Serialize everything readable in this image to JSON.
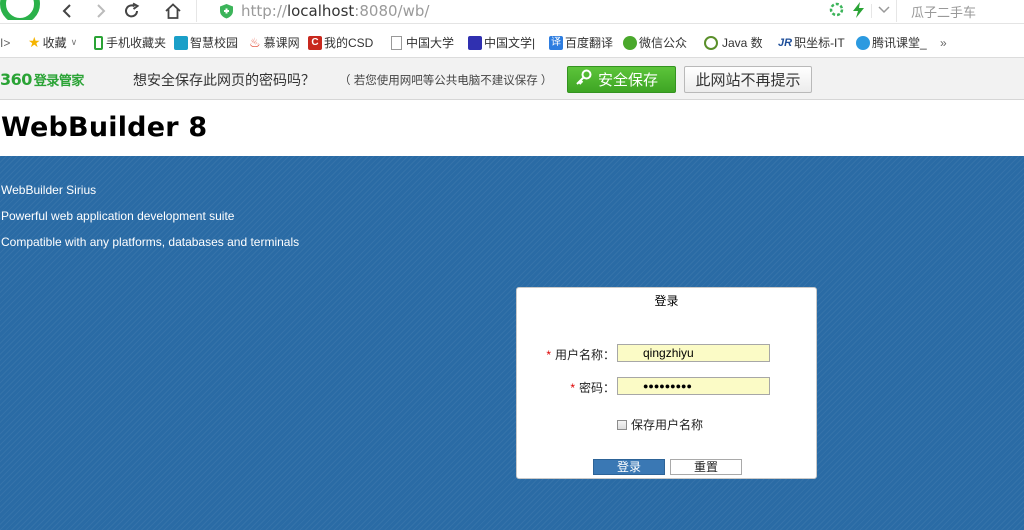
{
  "browser": {
    "url_prefix": "http://",
    "url_host": "localhost",
    "url_rest": ":8080/wb/",
    "search_hint": "瓜子二手车"
  },
  "bookmarks": [
    {
      "label": "收藏",
      "icon": "star-icon",
      "color": "#f5b400"
    },
    {
      "label": "手机收藏夹",
      "icon": "phone-icon",
      "color": "#2aa335"
    },
    {
      "label": "智慧校园",
      "icon": "campus-icon",
      "color": "#1a9fc8"
    },
    {
      "label": "慕课网",
      "icon": "flame-icon",
      "color": "#e0402a"
    },
    {
      "label": "我的CSD",
      "icon": "csdn-icon",
      "color": "#c8281e"
    },
    {
      "label": "中国大学",
      "icon": "page-icon",
      "color": "#888888"
    },
    {
      "label": "中国文学|",
      "icon": "book-icon",
      "color": "#3030b0"
    },
    {
      "label": "百度翻译",
      "icon": "translate-icon",
      "color": "#2d7de0"
    },
    {
      "label": "微信公众",
      "icon": "wechat-icon",
      "color": "#4aa82c"
    },
    {
      "label": "Java 数",
      "icon": "java-icon",
      "color": "#5a8f2a"
    },
    {
      "label": "职坐标-IT",
      "icon": "zzb-icon",
      "color": "#1f4f9a"
    },
    {
      "label": "腾讯课堂_",
      "icon": "tencent-icon",
      "color": "#2c9ae0"
    }
  ],
  "password_bar": {
    "logo": "360",
    "logo_sub": "登录管家",
    "question": "想安全保存此网页的密码吗？",
    "note": "（ 若您使用网吧等公共电脑不建议保存 ）",
    "save_label": "安全保存",
    "never_label": "此网站不再提示"
  },
  "page": {
    "title": "WebBuilder 8",
    "intro": [
      "WebBuilder Sirius",
      "Powerful web application development suite",
      "Compatible with any platforms, databases and terminals"
    ],
    "colors": {
      "blue": "#2a6ba5",
      "button": "#3a78b4",
      "input_bg": "#fbfbc6"
    }
  },
  "login": {
    "title": "登录",
    "username_label": "用户名称：",
    "username_value": "qingzhiyu",
    "password_label": "密码：",
    "password_value": "●●●●●●●●●",
    "required_mark": "*",
    "remember_label": "保存用户名称",
    "remember_checked": false,
    "login_label": "登录",
    "reset_label": "重置"
  }
}
